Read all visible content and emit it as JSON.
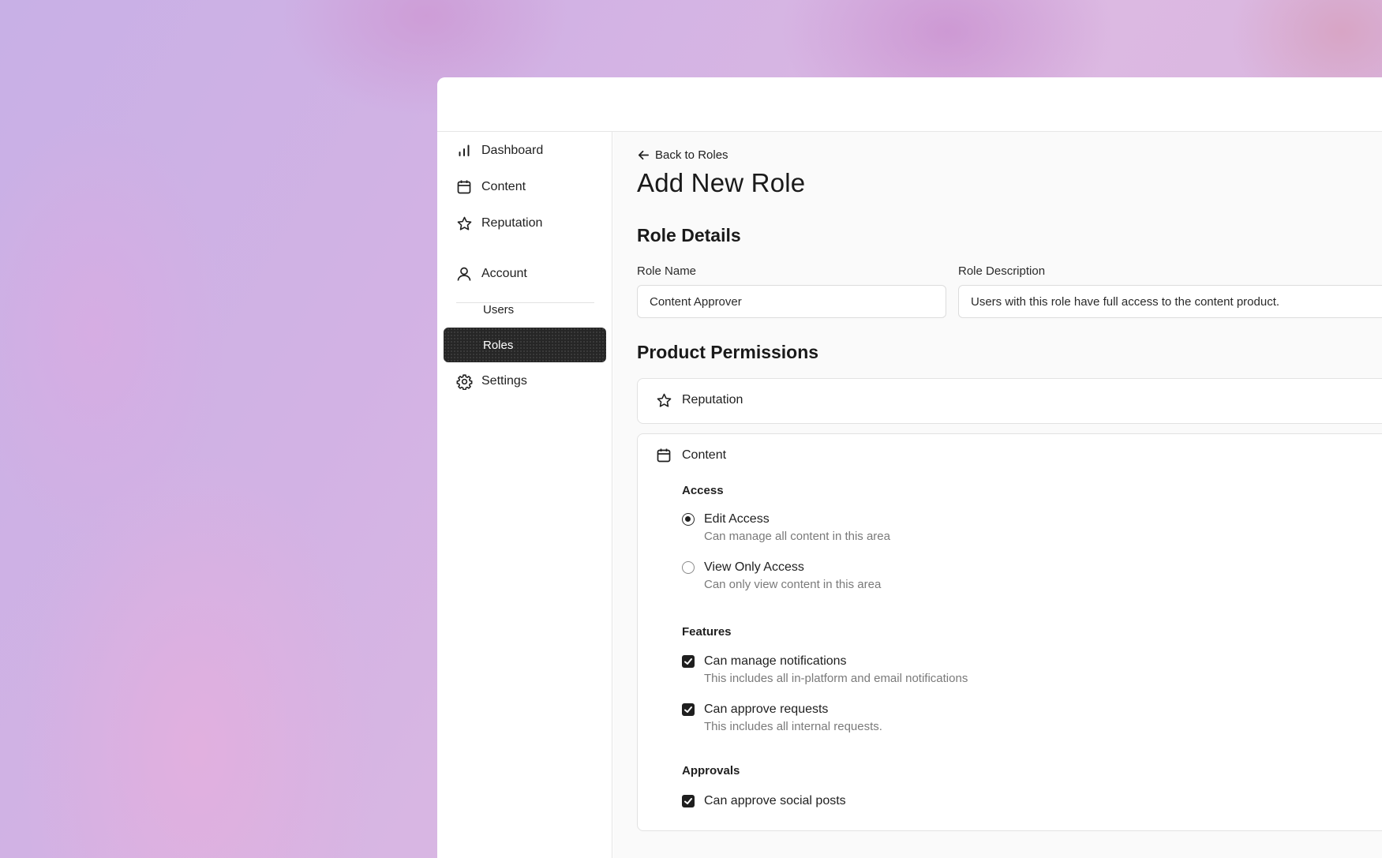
{
  "sidebar": {
    "items": [
      {
        "label": "Dashboard",
        "icon": "bar-chart-icon"
      },
      {
        "label": "Content",
        "icon": "calendar-icon"
      },
      {
        "label": "Reputation",
        "icon": "star-icon"
      },
      {
        "label": "Account",
        "icon": "user-icon"
      },
      {
        "label": "Users"
      },
      {
        "label": "Roles",
        "active": true
      },
      {
        "label": "Settings",
        "icon": "gear-icon"
      }
    ]
  },
  "main": {
    "back_label": "Back to Roles",
    "title": "Add New Role",
    "role_details": {
      "title": "Role Details",
      "name_label": "Role Name",
      "name_value": "Content Approver",
      "description_label": "Role Description",
      "description_value": "Users with this role have full access to the content product."
    },
    "permissions": {
      "title": "Product Permissions",
      "reputation": {
        "label": "Reputation",
        "icon": "star-icon"
      },
      "content": {
        "label": "Content",
        "icon": "calendar-icon",
        "access": {
          "title": "Access",
          "options": [
            {
              "label": "Edit Access",
              "desc": "Can manage all content in this area",
              "selected": true
            },
            {
              "label": "View Only Access",
              "desc": "Can only view content in this area",
              "selected": false
            }
          ]
        },
        "features": {
          "title": "Features",
          "options": [
            {
              "label": "Can manage notifications",
              "desc": "This includes all in-platform and email notifications",
              "checked": true
            },
            {
              "label": "Can approve requests",
              "desc": "This includes all internal requests.",
              "checked": true
            }
          ]
        },
        "approvals": {
          "title": "Approvals",
          "options": [
            {
              "label": "Can approve social posts",
              "checked": true
            }
          ]
        }
      }
    }
  },
  "colors": {
    "active_nav_bg": "#262626",
    "card_border": "#e2e2e2",
    "muted_text": "#7a7a7a"
  }
}
